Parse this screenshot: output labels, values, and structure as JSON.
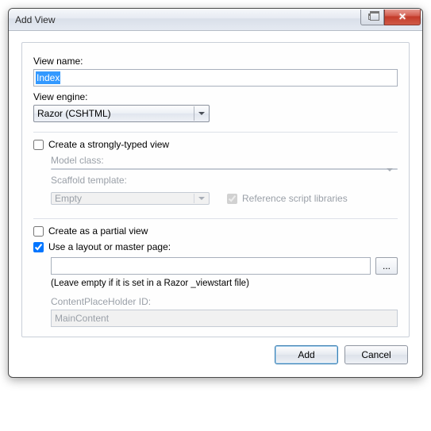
{
  "window": {
    "title": "Add View"
  },
  "fields": {
    "view_name_label": "View name:",
    "view_name_value": "Index",
    "view_engine_label": "View engine:",
    "view_engine_value": "Razor (CSHTML)"
  },
  "strong": {
    "checkbox_label": "Create a strongly-typed view",
    "checked": false,
    "model_class_label": "Model class:",
    "model_class_value": "",
    "scaffold_label": "Scaffold template:",
    "scaffold_value": "Empty",
    "reference_libs_label": "Reference script libraries",
    "reference_libs_checked": true
  },
  "partial": {
    "checkbox_label": "Create as a partial view",
    "checked": false
  },
  "layout": {
    "checkbox_label": "Use a layout or master page:",
    "checked": true,
    "path_value": "",
    "browse_label": "...",
    "hint": "(Leave empty if it is set in a Razor _viewstart file)",
    "cph_label": "ContentPlaceHolder ID:",
    "cph_value": "MainContent"
  },
  "buttons": {
    "add": "Add",
    "cancel": "Cancel"
  }
}
